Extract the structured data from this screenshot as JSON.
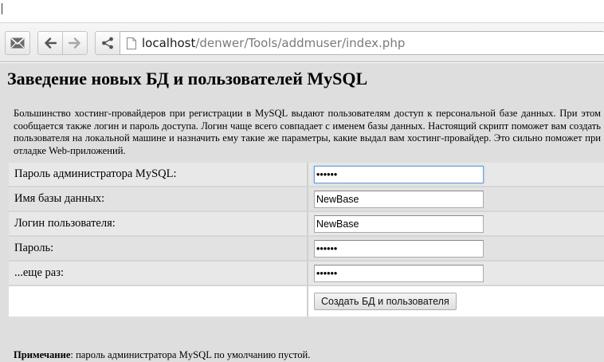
{
  "browser": {
    "url_host": "localhost",
    "url_path": "/denwer/Tools/addmuser/index.php",
    "icons": {
      "mail": "mail-icon",
      "back": "arrow-left-icon",
      "forward": "arrow-right-icon",
      "share": "share-icon",
      "page": "page-icon"
    }
  },
  "page": {
    "title": "Заведение новых БД и пользователей MySQL",
    "intro": "Большинство хостинг-провайдеров при регистрации в MySQL выдают пользователям доступ к персональной базе данных. При этом сообщается также логин и пароль доступа. Логин чаще всего совпадает с именем базы данных. Настоящий скрипт поможет вам создать пользователя на локальной машине и назначить ему такие же параметры, какие выдал вам хостинг-провайдер. Это сильно поможет при отладке Web-приложений.",
    "form": {
      "admin_password_label": "Пароль администратора MySQL:",
      "admin_password_value": "••••••",
      "db_name_label": "Имя базы данных:",
      "db_name_value": "NewBase",
      "user_login_label": "Логин пользователя:",
      "user_login_value": "NewBase",
      "password_label": "Пароль:",
      "password_value": "••••••",
      "password_repeat_label": "...еще раз:",
      "password_repeat_value": "••••••",
      "submit_label": "Создать БД и пользователя"
    },
    "note_prefix": "Примечание",
    "note_text": ": пароль администратора MySQL по умолчанию пустой."
  }
}
